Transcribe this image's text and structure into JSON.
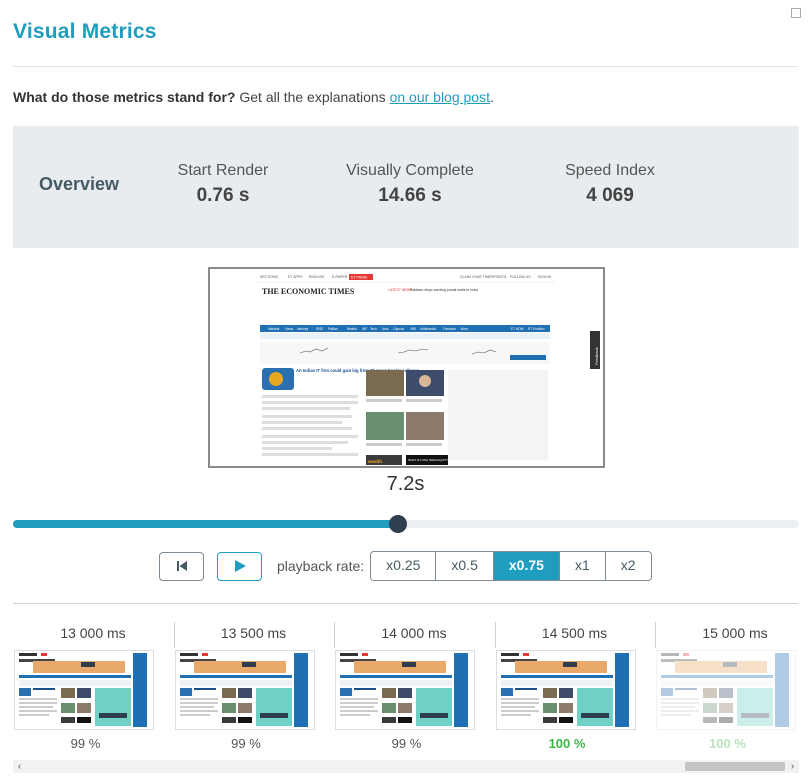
{
  "title": "Visual Metrics",
  "blurb": {
    "question": "What do those metrics stand for?",
    "text": " Get all the explanations ",
    "link": "on our blog post",
    "end": "."
  },
  "overview": {
    "label": "Overview",
    "metrics": [
      {
        "label": "Start Render",
        "value": "0.76 s"
      },
      {
        "label": "Visually Complete",
        "value": "14.66 s"
      },
      {
        "label": "Speed Index",
        "value": "4 069"
      }
    ]
  },
  "player": {
    "current_time": "7.2s",
    "progress": 0.49,
    "rate_label": "playback rate:",
    "rates": [
      "x0.25",
      "x0.5",
      "x0.75",
      "x1",
      "x2"
    ],
    "active_rate": "x0.75"
  },
  "screenshot_text": {
    "masthead": "THE ECONOMIC TIMES",
    "sections": "SECTIONS",
    "et_apps": "ET APPS",
    "english": "ENGLISH",
    "epaper": "E-PAPER",
    "et_prime": "ET PRIME",
    "claim": "CLAIM YOUR TIMESPOINTS",
    "follow": "FOLLOW US",
    "signin": "SIGN IN",
    "latest": "LATEST NEWS",
    "ticker": "Pakistan stops sending postal mails to India",
    "nav": [
      "Markets",
      "News",
      "Industry",
      "RISE",
      "Politics",
      "Wealth",
      "MF",
      "Tech",
      "Jobs",
      "Opinion",
      "NRI",
      "Multimedia",
      "Panache",
      "More"
    ],
    "et_now": "ET NOW",
    "et_portfolio": "ET Portfolio",
    "headline": "An Indian IT firm could gain big from Thomas Cook's collapse",
    "feedback": "Feedback",
    "wealth": "wealth",
    "equity": "WHAT IS LONG TERM EQUITY INVESTING?"
  },
  "filmstrip": [
    {
      "time": "13 000 ms",
      "pct": "99 %",
      "done": false,
      "faded": false
    },
    {
      "time": "13 500 ms",
      "pct": "99 %",
      "done": false,
      "faded": false
    },
    {
      "time": "14 000 ms",
      "pct": "99 %",
      "done": false,
      "faded": false
    },
    {
      "time": "14 500 ms",
      "pct": "100 %",
      "done": true,
      "faded": false
    },
    {
      "time": "15 000 ms",
      "pct": "100 %",
      "done": true,
      "faded": true
    }
  ],
  "colors": {
    "accent": "#1f9dbf",
    "complete": "#3fb54a",
    "knob": "#2e3e4e"
  }
}
